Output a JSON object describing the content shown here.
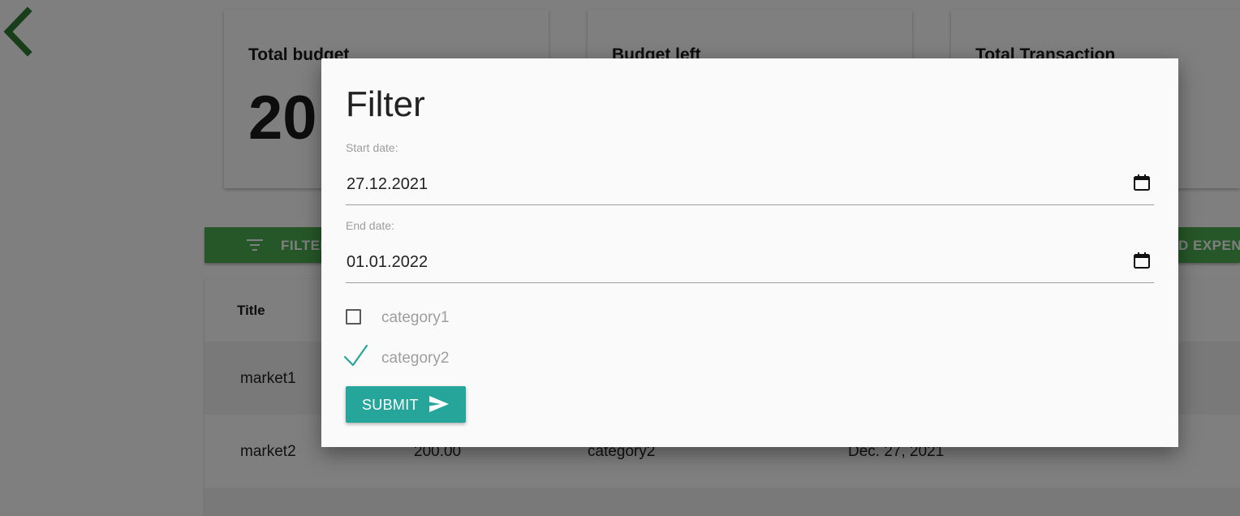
{
  "colors": {
    "accent_green": "#4caf50",
    "back_arrow": "#2e7d32",
    "submit_teal": "#26a69a",
    "check_teal": "#26a69a"
  },
  "nav": {
    "back_icon": "chevron-left-icon"
  },
  "cards": [
    {
      "title": "Total budget",
      "value": "20"
    },
    {
      "title": "Budget left",
      "value": ""
    },
    {
      "title": "Total Transaction",
      "value": ""
    }
  ],
  "actions": {
    "filter_label": "FILTER",
    "filter_icon": "filter-icon",
    "add_label": "D EXPENS"
  },
  "table": {
    "headers": [
      "Title"
    ],
    "rows": [
      [
        "market1"
      ],
      [
        "market2",
        "200.00",
        "category2",
        "Dec. 27, 2021"
      ]
    ]
  },
  "dialog": {
    "title": "Filter",
    "start_date_label": "Start date:",
    "start_date_value": "27.12.2021",
    "end_date_label": "End date:",
    "end_date_value": "01.01.2022",
    "categories": [
      {
        "label": "category1",
        "checked": false
      },
      {
        "label": "category2",
        "checked": true
      }
    ],
    "submit_label": "SUBMIT",
    "submit_icon": "send-icon",
    "calendar_icon": "calendar-icon"
  }
}
